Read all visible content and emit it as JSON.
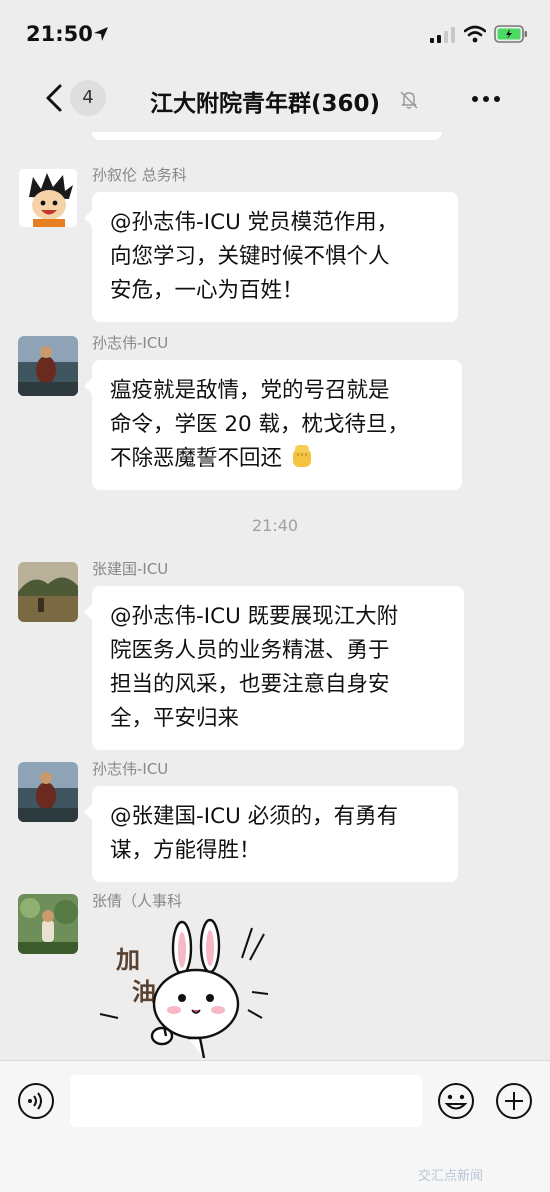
{
  "status_bar": {
    "time": "21:50"
  },
  "nav": {
    "back_count": "4",
    "title": "江大附院青年群(360)"
  },
  "messages": [
    {
      "sender": "孙叙伦 总务科",
      "lines": [
        "@孙志伟-ICU 党员模范作用，",
        "向您学习，关键时候不惧个人",
        "安危，一心为百姓！"
      ]
    },
    {
      "sender": "孙志伟-ICU",
      "lines": [
        "瘟疫就是敌情，党的号召就是",
        "命令，学医 20 载，枕戈待旦，",
        "不除恶魔誓不回还"
      ]
    },
    {
      "sender": "张建国-ICU",
      "lines": [
        "@孙志伟-ICU 既要展现江大附",
        "院医务人员的业务精湛、勇于",
        "担当的风采，也要注意自身安",
        "全，平安归来"
      ]
    },
    {
      "sender": "孙志伟-ICU",
      "lines": [
        "@张建国-ICU 必须的，有勇有",
        "谋，方能得胜！"
      ]
    },
    {
      "sender": "张倩（人事科"
    }
  ],
  "timestamp": "21:40",
  "sticker": {
    "text_line1": "加",
    "text_line2": "油"
  },
  "watermark": "交汇点新闻",
  "colors": {
    "background": "#ededed",
    "bubble": "#ffffff",
    "sender": "#888888",
    "battery_green": "#4cd964"
  },
  "icons": [
    "location-arrow-icon",
    "signal-icon",
    "wifi-icon",
    "battery-icon",
    "back-chevron-icon",
    "mute-bell-icon",
    "more-dots-icon",
    "fist-emoji-icon",
    "voice-icon",
    "emoji-face-icon",
    "plus-icon"
  ]
}
